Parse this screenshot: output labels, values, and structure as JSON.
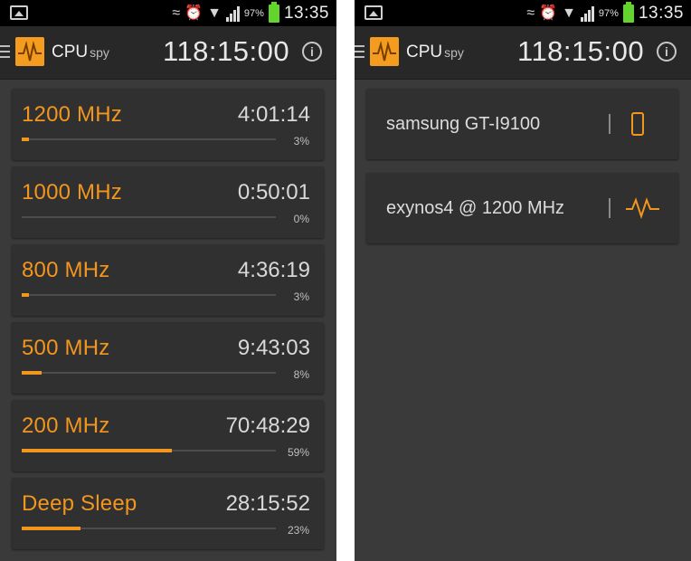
{
  "status_bar": {
    "battery_percent": "97%",
    "time": "13:35",
    "icons": [
      "image-icon",
      "muted-icon",
      "alarm-icon",
      "wifi-icon",
      "signal-icon",
      "battery-icon"
    ],
    "battery_color": "#62d42b"
  },
  "app": {
    "name": "CPU",
    "name_suffix": "spy",
    "total_time": "118:15:00",
    "accent_color": "#f2961e"
  },
  "states": [
    {
      "freq": "1200 MHz",
      "time": "4:01:14",
      "percent_label": "3%",
      "percent": 3
    },
    {
      "freq": "1000 MHz",
      "time": "0:50:01",
      "percent_label": "0%",
      "percent": 0
    },
    {
      "freq": "800 MHz",
      "time": "4:36:19",
      "percent_label": "3%",
      "percent": 3
    },
    {
      "freq": "500 MHz",
      "time": "9:43:03",
      "percent_label": "8%",
      "percent": 8
    },
    {
      "freq": "200 MHz",
      "time": "70:48:29",
      "percent_label": "59%",
      "percent": 59
    },
    {
      "freq": "Deep Sleep",
      "time": "28:15:52",
      "percent_label": "23%",
      "percent": 23
    }
  ],
  "device_info": {
    "device": "samsung GT-I9100",
    "kernel": "exynos4 @ 1200 MHz"
  }
}
